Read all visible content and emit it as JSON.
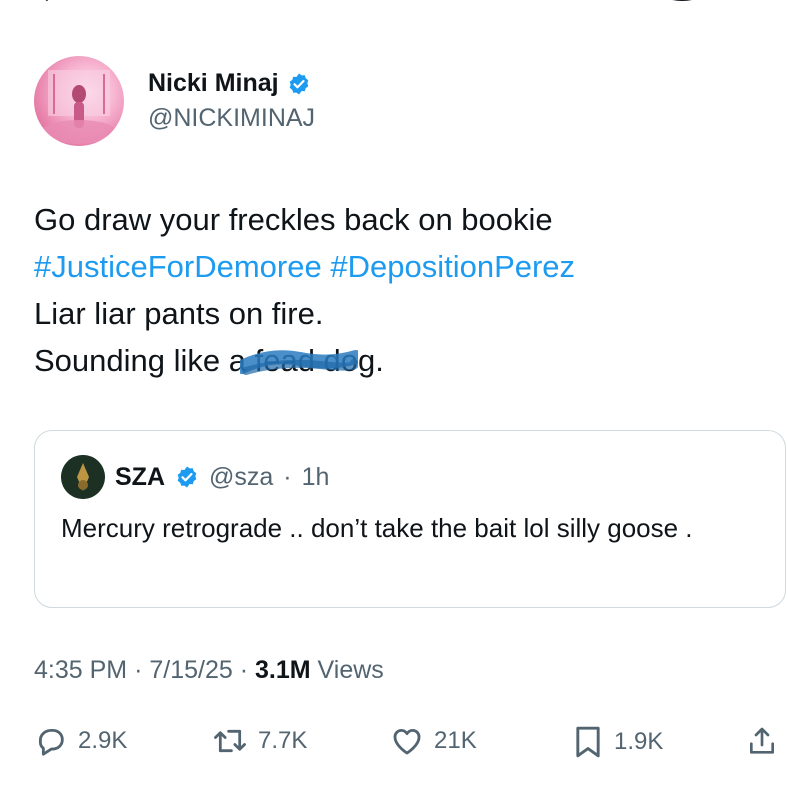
{
  "author": {
    "name": "Nicki Minaj",
    "handle": "@NICKIMINAJ",
    "verified_color": "#1d9bf0",
    "avatar_icon": "avatar-photo"
  },
  "tweet": {
    "line1": "Go draw your freckles back on bookie",
    "hashtag1": "#JusticeForDemoree",
    "hashtag2": "#DepositionPerez",
    "line3": "Liar liar pants on fire.",
    "line4_start": "Sounding like a f",
    "line4_end": "ead dog.",
    "hashtag_color": "#1d9bf0"
  },
  "quote": {
    "name": "SZA",
    "handle": "@sza",
    "separator": "·",
    "time": "1h",
    "text": "Mercury retrograde .. don’t take the bait lol silly goose ."
  },
  "meta": {
    "time": "4:35 PM",
    "sep1": "·",
    "date": "7/15/25",
    "sep2": "·",
    "views_count": "3.1M",
    "views_label": "Views"
  },
  "actions": {
    "reply": {
      "icon": "reply-icon",
      "count": "2.9K"
    },
    "repost": {
      "icon": "repost-icon",
      "count": "7.7K"
    },
    "like": {
      "icon": "heart-icon",
      "count": "21K"
    },
    "bookmark": {
      "icon": "bookmark-icon",
      "count": "1.9K"
    },
    "share": {
      "icon": "share-icon"
    }
  }
}
